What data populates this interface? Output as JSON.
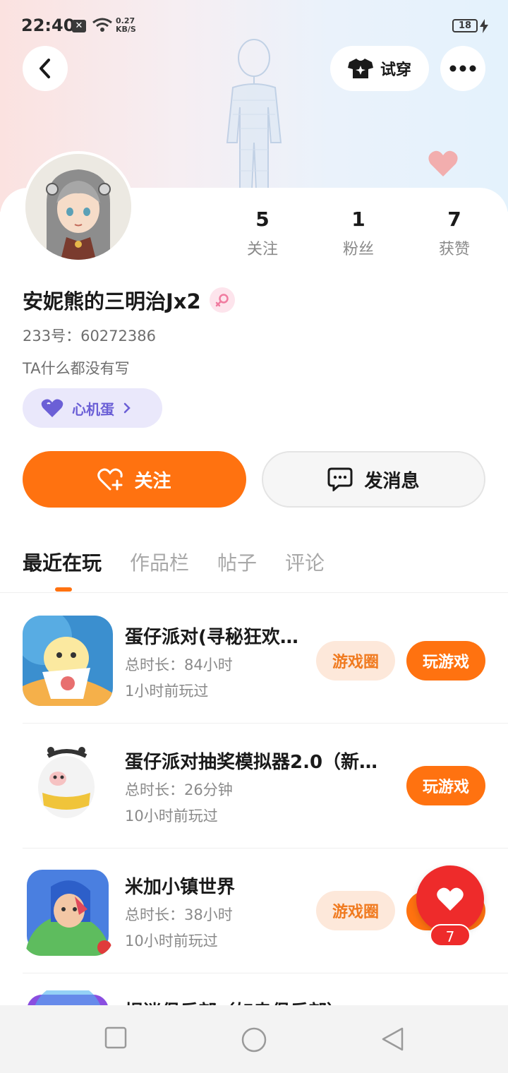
{
  "status_bar": {
    "time": "22:40",
    "speed_value": "0.27",
    "speed_unit": "KB/S",
    "battery": "18"
  },
  "header": {
    "try_on_label": "试穿"
  },
  "profile": {
    "stats": [
      {
        "value": "5",
        "label": "关注"
      },
      {
        "value": "1",
        "label": "粉丝"
      },
      {
        "value": "7",
        "label": "获赞"
      }
    ],
    "name": "安妮熊的三明治Jx2",
    "uid_text": "233号：60272386",
    "bio": "TA什么都没有写",
    "heart_egg_label": "心机蛋"
  },
  "actions": {
    "follow_label": "关注",
    "message_label": "发消息"
  },
  "tabs": [
    "最近在玩",
    "作品栏",
    "帖子",
    "评论"
  ],
  "games": [
    {
      "title": "蛋仔派对(寻秘狂欢…",
      "duration": "总时长：84小时",
      "last_played": "1小时前玩过",
      "circle_label": "游戏圈",
      "play_label": "玩游戏"
    },
    {
      "title": "蛋仔派对抽奖模拟器2.0（新…",
      "duration": "总时长：26分钟",
      "last_played": "10小时前玩过",
      "play_label": "玩游戏"
    },
    {
      "title": "米加小镇世界",
      "duration": "总时长：38小时",
      "last_played": "10小时前玩过",
      "circle_label": "游戏圈",
      "play_label": "玩游戏"
    },
    {
      "title": "捉迷俱乐部（如幸俱乐部）"
    }
  ],
  "floating_like": {
    "count": "7"
  },
  "colors": {
    "accent": "#ff7210",
    "like_red": "#ee2b2b",
    "egg_purple": "#6b5fd6"
  }
}
